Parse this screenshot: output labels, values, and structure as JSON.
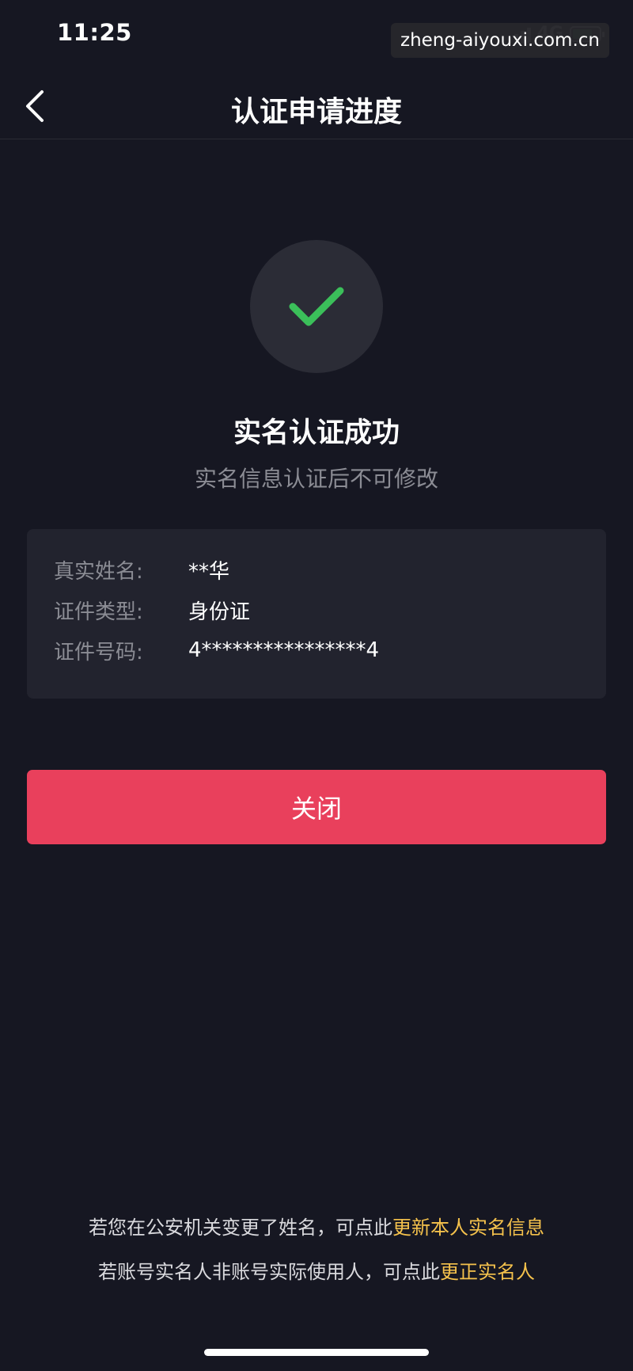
{
  "status_bar": {
    "time": "11:25",
    "network": "4G",
    "watermark": "zheng-aiyouxi.com.cn"
  },
  "nav": {
    "title": "认证申请进度",
    "back_icon": "chevron-left-icon"
  },
  "result": {
    "icon": "checkmark-icon",
    "icon_color": "#3bbf5a",
    "title": "实名认证成功",
    "subtitle": "实名信息认证后不可修改"
  },
  "info": {
    "rows": [
      {
        "label": "真实姓名:",
        "value": "**华"
      },
      {
        "label": "证件类型:",
        "value": "身份证"
      },
      {
        "label": "证件号码:",
        "value": "4****************4"
      }
    ]
  },
  "close_button": {
    "label": "关闭",
    "color": "#e9405c"
  },
  "footer": {
    "line1_text": "若您在公安机关变更了姓名，可点此",
    "line1_link": "更新本人实名信息",
    "line2_text": "若账号实名人非账号实际使用人，可点此",
    "line2_link": "更正实名人",
    "link_color": "#f5c24c"
  }
}
